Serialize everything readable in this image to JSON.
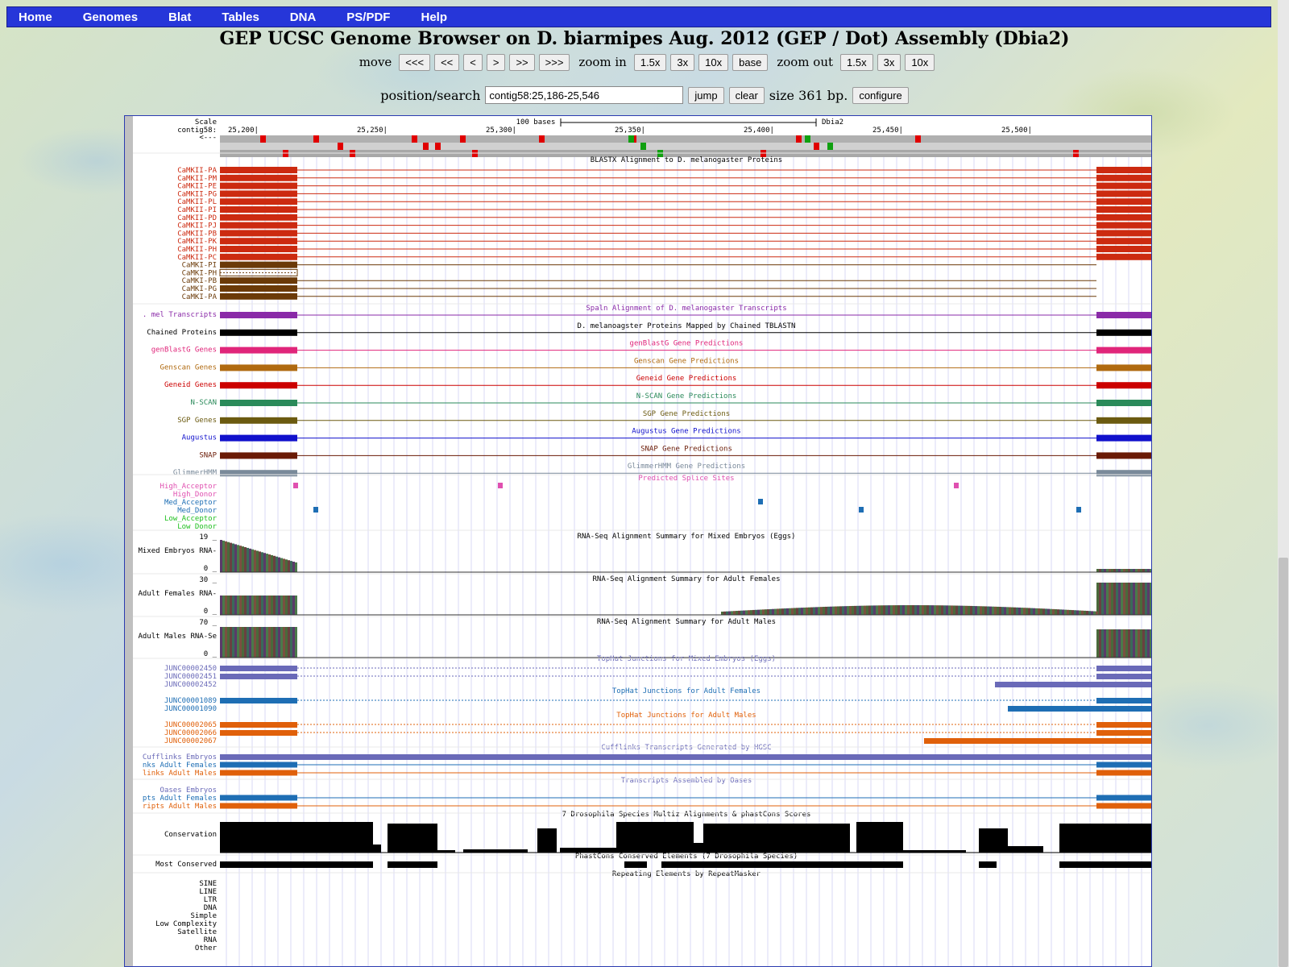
{
  "menu": [
    "Home",
    "Genomes",
    "Blat",
    "Tables",
    "DNA",
    "PS/PDF",
    "Help"
  ],
  "title": "GEP UCSC Genome Browser on D. biarmipes Aug. 2012 (GEP / Dot) Assembly (Dbia2)",
  "nav": {
    "move_label": "move",
    "move_buttons": [
      "<<<",
      "<<",
      "<",
      ">",
      ">>",
      ">>>"
    ],
    "zoom_in_label": "zoom in",
    "zoom_in_buttons": [
      "1.5x",
      "3x",
      "10x",
      "base"
    ],
    "zoom_out_label": "zoom out",
    "zoom_out_buttons": [
      "1.5x",
      "3x",
      "10x"
    ]
  },
  "position": {
    "label": "position/search",
    "value": "contig58:25,186-25,546",
    "jump": "jump",
    "clear": "clear",
    "size_text": "size 361 bp.",
    "configure": "configure"
  },
  "ruler": {
    "scale_label": "Scale",
    "chrom_label": "contig58:",
    "strand_label": "<---",
    "bases_text": "100 bases",
    "assembly": "Dbia2",
    "ticks": [
      "25,200",
      "25,250",
      "25,300",
      "25,350",
      "25,400",
      "25,450",
      "25,500"
    ]
  },
  "tracks": {
    "blastx": {
      "title": "BLASTX Alignment to D. melanogaster Proteins",
      "rows": [
        "CaMKII-PA",
        "CaMKII-PM",
        "CaMKII-PE",
        "CaMKII-PG",
        "CaMKII-PL",
        "CaMKII-PI",
        "CaMKII-PD",
        "CaMKII-PJ",
        "CaMKII-PB",
        "CaMKII-PK",
        "CaMKII-PH",
        "CaMKII-PC",
        "CaMKI-PI",
        "CaMKI-PH",
        "CaMKI-PB",
        "CaMKI-PG",
        "CaMKI-PA"
      ]
    },
    "simple": [
      {
        "label": ". mel Transcripts",
        "title": "Spaln Alignment of D. melanogaster Transcripts",
        "color": "#8a2aa8"
      },
      {
        "label": "Chained Proteins",
        "title": "D. melanoagster Proteins Mapped by Chained TBLASTN",
        "color": "#000000"
      },
      {
        "label": "genBlastG Genes",
        "title": "genBlastG Gene Predictions",
        "color": "#e0257a"
      },
      {
        "label": "Genscan Genes",
        "title": "Genscan Gene Predictions",
        "color": "#b06a10"
      },
      {
        "label": "Geneid Genes",
        "title": "Geneid Gene Predictions",
        "color": "#cc0000"
      },
      {
        "label": "N-SCAN",
        "title": "N-SCAN Gene Predictions",
        "color": "#2a8a5a"
      },
      {
        "label": "SGP Genes",
        "title": "SGP Gene Predictions",
        "color": "#6b5a10"
      },
      {
        "label": "Augustus",
        "title": "Augustus Gene Predictions",
        "color": "#1010cc"
      },
      {
        "label": "SNAP",
        "title": "SNAP Gene Predictions",
        "color": "#6a1a05"
      },
      {
        "label": "GlimmerHMM",
        "title": "GlimmerHMM Gene Predictions",
        "color": "#7a8a9a"
      }
    ],
    "splice": {
      "title": "Predicted Splice Sites",
      "rows": [
        "High_Acceptor",
        "High_Donor",
        "Med_Acceptor",
        "Med_Donor",
        "Low_Acceptor",
        "Low_Donor"
      ]
    },
    "rnaseq": [
      {
        "label": "Mixed Embryos RNA-",
        "title": "RNA-Seq Alignment Summary for Mixed Embryos (Eggs)",
        "max": "19",
        "min": "0"
      },
      {
        "label": "Adult Females RNA-",
        "title": "RNA-Seq Alignment Summary for Adult Females",
        "max": "30",
        "min": "0"
      },
      {
        "label": "Adult Males RNA-Se",
        "title": "RNA-Seq Alignment Summary for Adult Males",
        "max": "70",
        "min": "0"
      }
    ],
    "tophat": [
      {
        "title": "TopHat Junctions for Mixed Embryos (Eggs)",
        "rows": [
          "JUNC00002450",
          "JUNC00002451",
          "JUNC00002452"
        ],
        "color": "#6a6ab8"
      },
      {
        "title": "TopHat Junctions for Adult Females",
        "rows": [
          "JUNC00001089",
          "JUNC00001090"
        ],
        "color": "#1e6eb4"
      },
      {
        "title": "TopHat Junctions for Adult Males",
        "rows": [
          "JUNC00002065",
          "JUNC00002066",
          "JUNC00002067"
        ],
        "color": "#e0600a"
      }
    ],
    "cufflinks": {
      "title": "Cufflinks Transcripts Generated by HGSC",
      "rows": [
        "Cufflinks Embryos",
        "nks Adult Females",
        "links Adult Males"
      ]
    },
    "oases": {
      "title": "Transcripts Assembled by Oases",
      "rows": [
        "Oases Embryos",
        "pts Adult Females",
        "ripts Adult Males"
      ]
    },
    "conservation": {
      "label": "Conservation",
      "title": "7 Drosophila Species Multiz Alignments & phastCons Scores"
    },
    "most_conserved": {
      "label": "Most Conserved",
      "title": "PhastCons Conserved Elements (7 Drosophila Species)"
    },
    "repeatmasker": {
      "title": "Repeating Elements by RepeatMasker",
      "rows": [
        "SINE",
        "LINE",
        "LTR",
        "DNA",
        "Simple",
        "Low Complexity",
        "Satellite",
        "RNA",
        "Other"
      ]
    }
  },
  "colors": {
    "blastx_red": "#cc2a10",
    "camki_brown": "#6b3a08",
    "menu_bg": "#2636d9"
  }
}
